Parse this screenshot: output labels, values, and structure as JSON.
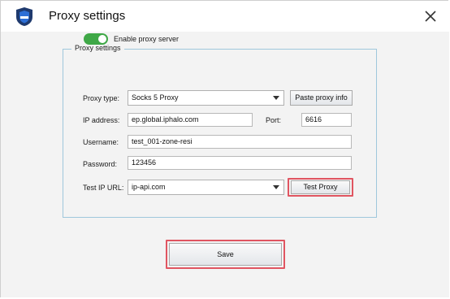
{
  "window": {
    "title": "Proxy settings",
    "close_icon": "close-icon",
    "logo_icon": "shield-logo-icon"
  },
  "group": {
    "legend": "Proxy settings"
  },
  "enable_proxy": {
    "label": "Enable proxy server",
    "enabled": true
  },
  "proxy_type": {
    "label": "Proxy type:",
    "value": "Socks 5 Proxy"
  },
  "paste_button": {
    "label": "Paste proxy info"
  },
  "ip_address": {
    "label": "IP address:",
    "value": "ep.global.iphalo.com"
  },
  "port": {
    "label": "Port:",
    "value": "6616"
  },
  "username": {
    "label": "Username:",
    "value": "test_001-zone-resi"
  },
  "password": {
    "label": "Password:",
    "value": "123456"
  },
  "test_ip_url": {
    "label": "Test IP URL:",
    "value": "ip-api.com"
  },
  "test_button": {
    "label": "Test Proxy"
  },
  "save_button": {
    "label": "Save"
  },
  "colors": {
    "toggle_on": "#3fa847",
    "highlight": "#e05561",
    "group_border": "#9fc7dc",
    "logo_bg": "#1f3a6e"
  }
}
